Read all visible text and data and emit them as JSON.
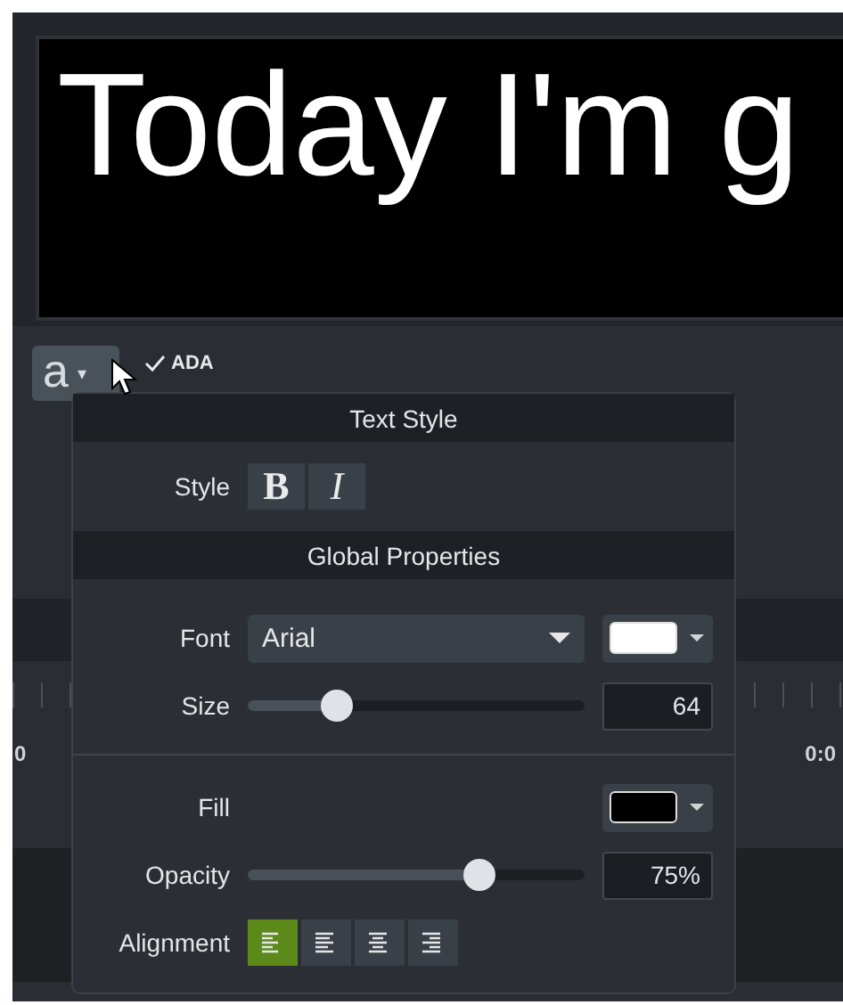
{
  "preview": {
    "caption": "Today I'm g"
  },
  "toolbar": {
    "format_button": {
      "label": "a",
      "caret": "▾"
    },
    "ada": {
      "label": "ADA",
      "checked": true
    }
  },
  "timeline": {
    "labels": [
      "0",
      "0:0"
    ]
  },
  "popup": {
    "sections": [
      {
        "title": "Text Style",
        "rows": [
          {
            "kind": "style",
            "label": "Style",
            "buttons": [
              {
                "label": "B",
                "selected": false
              },
              {
                "label": "I",
                "selected": false
              }
            ]
          }
        ]
      },
      {
        "title": "Global Properties",
        "rows": [
          {
            "kind": "font",
            "label": "Font",
            "value": "Arial",
            "color": "#ffffff"
          },
          {
            "kind": "slider",
            "label": "Size",
            "level": 0.24,
            "value": "64"
          },
          {
            "kind": "divider"
          },
          {
            "kind": "color",
            "label": "Fill",
            "color": "#000000"
          },
          {
            "kind": "slider",
            "label": "Opacity",
            "level": 0.71,
            "value": "75%"
          },
          {
            "kind": "alignment",
            "label": "Alignment",
            "options": [
              {
                "kind": "left",
                "selected": true
              },
              {
                "kind": "justify",
                "selected": false
              },
              {
                "kind": "center",
                "selected": false
              },
              {
                "kind": "right",
                "selected": false
              }
            ]
          }
        ]
      }
    ]
  }
}
